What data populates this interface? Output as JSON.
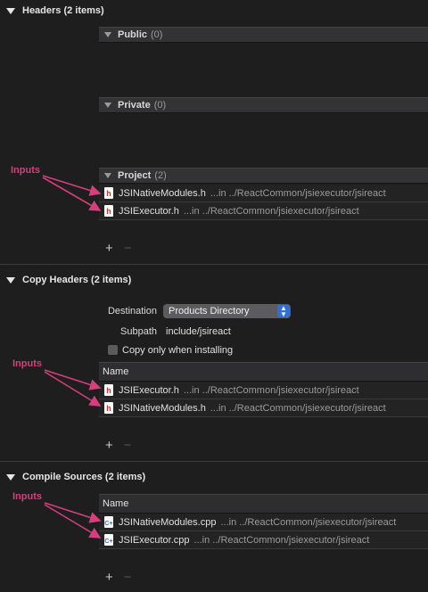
{
  "headers_phase": {
    "title": "Headers (2 items)",
    "groups": [
      {
        "name": "Public",
        "count": "(0)"
      },
      {
        "name": "Private",
        "count": "(0)"
      },
      {
        "name": "Project",
        "count": "(2)"
      }
    ],
    "project_files": [
      {
        "name": "JSINativeModules.h",
        "path": "...in ../ReactCommon/jsiexecutor/jsireact"
      },
      {
        "name": "JSIExecutor.h",
        "path": "...in ../ReactCommon/jsiexecutor/jsireact"
      }
    ],
    "annotation": "Inputs"
  },
  "copy_headers_phase": {
    "title": "Copy Headers (2 items)",
    "destination_label": "Destination",
    "destination_value": "Products Directory",
    "subpath_label": "Subpath",
    "subpath_value": "include/jsireact",
    "copy_only_label": "Copy only when installing",
    "column_header": "Name",
    "files": [
      {
        "name": "JSIExecutor.h",
        "path": "...in ../ReactCommon/jsiexecutor/jsireact"
      },
      {
        "name": "JSINativeModules.h",
        "path": "...in ../ReactCommon/jsiexecutor/jsireact"
      }
    ],
    "annotation": "Inputs"
  },
  "compile_sources_phase": {
    "title": "Compile Sources (2 items)",
    "column_header": "Name",
    "files": [
      {
        "name": "JSINativeModules.cpp",
        "path": "...in ../ReactCommon/jsiexecutor/jsireact"
      },
      {
        "name": "JSIExecutor.cpp",
        "path": "...in ../ReactCommon/jsiexecutor/jsireact"
      }
    ],
    "annotation": "Inputs"
  },
  "controls": {
    "add": "+",
    "remove": "−"
  },
  "icons": {
    "disclosure": "disclosure-triangle-icon",
    "header_file": "header-file-icon",
    "cpp_file": "cpp-file-icon",
    "popup_stepper": "popup-stepper-icon"
  },
  "colors": {
    "background": "#1e1e1e",
    "annotation": "#d43f7c",
    "popup_accent": "#2f6fd6",
    "header_icon_letter": "#cc3333"
  }
}
